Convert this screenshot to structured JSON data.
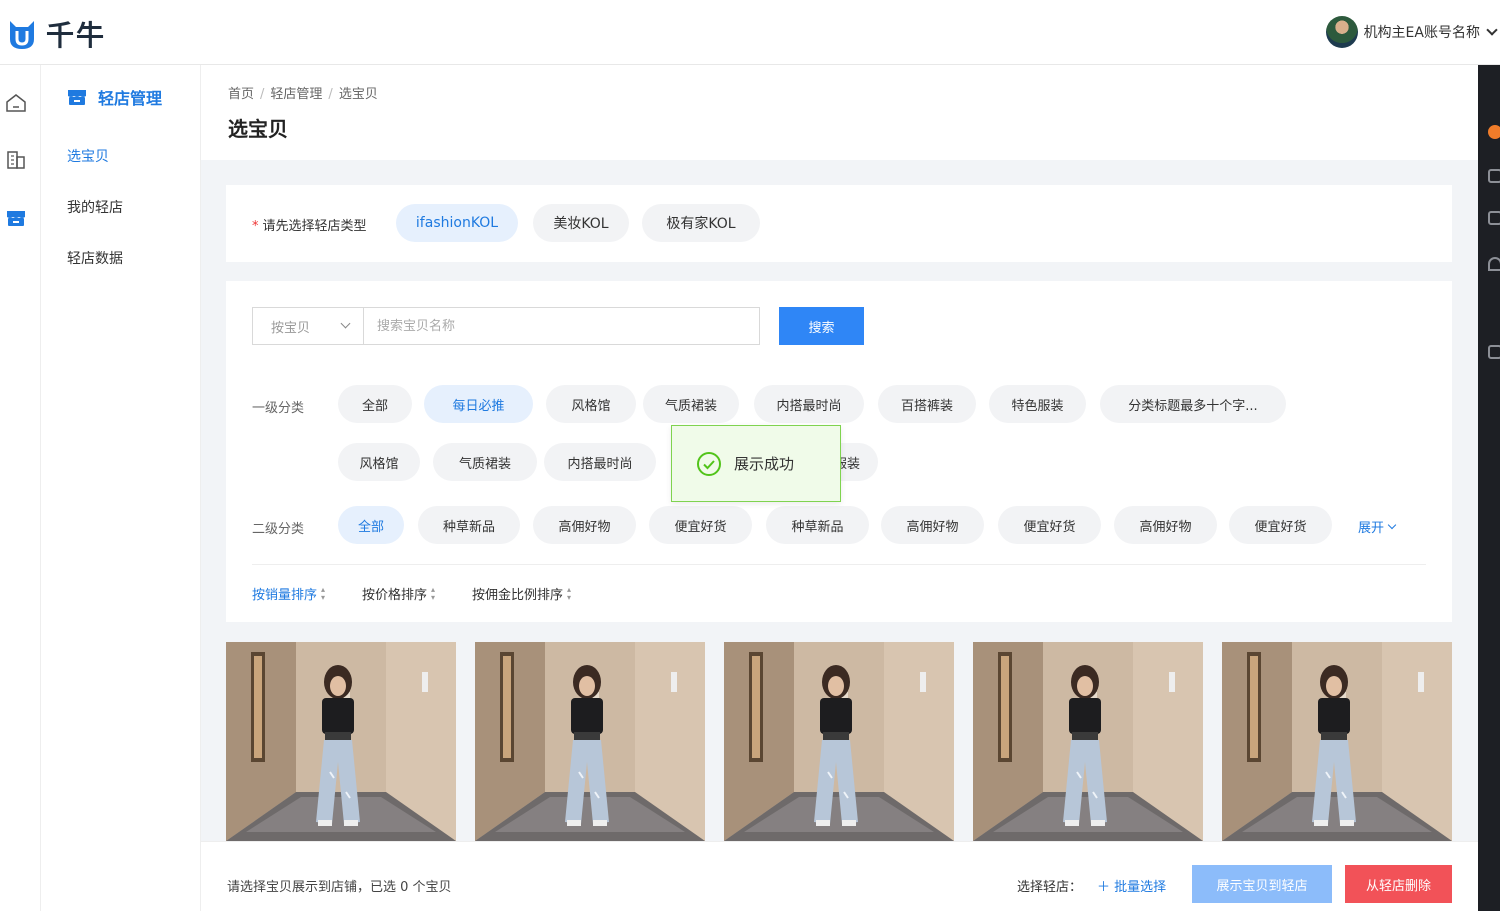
{
  "app": {
    "logo_text": "千牛",
    "brand_color": "#1f7ae0"
  },
  "user": {
    "name": "机构主EA账号名称"
  },
  "sidebar": {
    "section_title": "轻店管理",
    "items": [
      {
        "label": "选宝贝",
        "active": true
      },
      {
        "label": "我的轻店",
        "active": false
      },
      {
        "label": "轻店数据",
        "active": false
      }
    ]
  },
  "breadcrumb": [
    "首页",
    "轻店管理",
    "选宝贝"
  ],
  "page": {
    "title": "选宝贝"
  },
  "store_type": {
    "label": "请先选择轻店类型",
    "options": [
      {
        "label": "ifashionKOL",
        "selected": true
      },
      {
        "label": "美妆KOL",
        "selected": false
      },
      {
        "label": "极有家KOL",
        "selected": false
      }
    ]
  },
  "search": {
    "mode": "按宝贝",
    "placeholder": "搜索宝贝名称",
    "button": "搜索"
  },
  "category1": {
    "label": "一级分类",
    "row1": [
      "全部",
      "每日必推",
      "风格馆",
      "气质裙装",
      "内搭最时尚",
      "百搭裤装",
      "特色服装",
      "分类标题最多十个字..."
    ],
    "row2": [
      "风格馆",
      "气质裙装",
      "内搭最时尚",
      "服装"
    ],
    "active": "每日必推"
  },
  "category2": {
    "label": "二级分类",
    "items": [
      "全部",
      "种草新品",
      "高佣好物",
      "便宜好货",
      "种草新品",
      "高佣好物",
      "便宜好货",
      "高佣好物",
      "便宜好货"
    ],
    "active": "全部",
    "expand": "展开"
  },
  "sort": [
    {
      "label": "按销量排序",
      "active": true
    },
    {
      "label": "按价格排序",
      "active": false
    },
    {
      "label": "按佣金比例排序",
      "active": false
    }
  ],
  "toast": {
    "text": "展示成功"
  },
  "products_count": 5,
  "footer": {
    "info": "请选择宝贝展示到店铺，已选 0 个宝贝",
    "pick_label": "选择轻店：",
    "batch": "＋ 批量选择",
    "show_button": "展示宝贝到轻店",
    "delete_button": "从轻店删除"
  }
}
